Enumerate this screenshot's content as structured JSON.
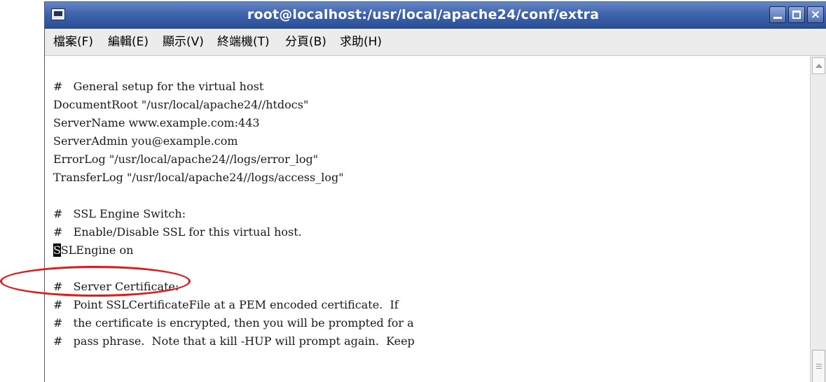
{
  "window": {
    "title": "root@localhost:/usr/local/apache24/conf/extra",
    "buttons": {
      "minimize": "_",
      "maximize": "□",
      "close": "×"
    }
  },
  "menu": [
    {
      "label": "檔案(F)"
    },
    {
      "label": "編輯(E)"
    },
    {
      "label": "顯示(V)"
    },
    {
      "label": "終端機(T)"
    },
    {
      "label": "分頁(B)"
    },
    {
      "label": "求助(H)"
    }
  ],
  "terminal": {
    "lines": [
      "",
      "#   General setup for the virtual host",
      "DocumentRoot \"/usr/local/apache24//htdocs\"",
      "ServerName www.example.com:443",
      "ServerAdmin you@example.com",
      "ErrorLog \"/usr/local/apache24//logs/error_log\"",
      "TransferLog \"/usr/local/apache24//logs/access_log\"",
      "",
      "#   SSL Engine Switch:",
      "#   Enable/Disable SSL for this virtual host.",
      "",
      "",
      "#   Server Certificate:",
      "#   Point SSLCertificateFile at a PEM encoded certificate.  If",
      "#   the certificate is encrypted, then you will be prompted for a",
      "#   pass phrase.  Note that a kill -HUP will prompt again.  Keep"
    ],
    "cursor_line": {
      "cursor_char": "S",
      "rest": "SLEngine on"
    }
  },
  "colors": {
    "titlebar": "#3f64ad",
    "menubar": "#ececec",
    "annotation": "#e01b1b"
  }
}
